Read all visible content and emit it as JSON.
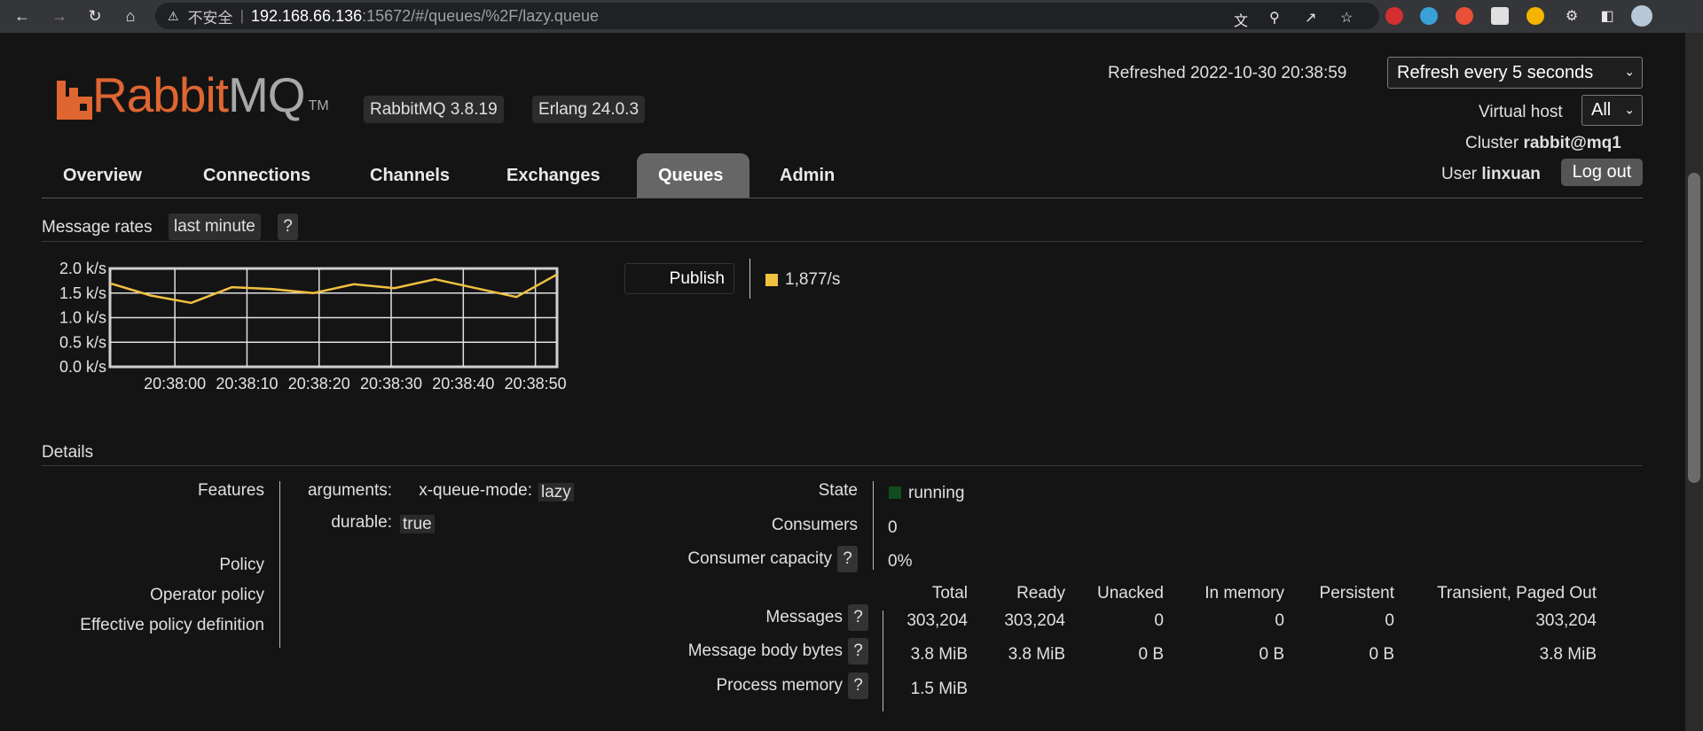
{
  "browser": {
    "security_label": "不安全",
    "url_host": "192.168.66.136",
    "url_path": ":15672/#/queues/%2F/lazy.queue"
  },
  "header": {
    "logo_rabbit": "Rabbit",
    "logo_mq": "MQ",
    "logo_tm": "TM",
    "version": "RabbitMQ 3.8.19",
    "erlang": "Erlang 24.0.3",
    "refreshed": "Refreshed 2022-10-30 20:38:59",
    "refresh_select": "Refresh every 5 seconds",
    "vhost_label": "Virtual host",
    "vhost_value": "All",
    "cluster_label": "Cluster",
    "cluster_value": "rabbit@mq1",
    "user_label": "User",
    "user_value": "linxuan",
    "logout_label": "Log out"
  },
  "tabs": [
    {
      "label": "Overview",
      "active": false
    },
    {
      "label": "Connections",
      "active": false
    },
    {
      "label": "Channels",
      "active": false
    },
    {
      "label": "Exchanges",
      "active": false
    },
    {
      "label": "Queues",
      "active": true
    },
    {
      "label": "Admin",
      "active": false
    }
  ],
  "message_rates": {
    "title": "Message rates",
    "range": "last minute",
    "help": "?",
    "legend_label": "Publish",
    "legend_value": "1,877/s",
    "legend_color": "#f0c040"
  },
  "chart_data": {
    "type": "line",
    "x": [
      "20:37:58",
      "20:38:03",
      "20:38:08",
      "20:38:13",
      "20:38:18",
      "20:38:23",
      "20:38:28",
      "20:38:33",
      "20:38:38",
      "20:38:43",
      "20:38:48",
      "20:38:53"
    ],
    "series": [
      {
        "name": "Publish",
        "color": "#f0c040",
        "values": [
          1700,
          1450,
          1300,
          1620,
          1580,
          1500,
          1680,
          1600,
          1780,
          1600,
          1420,
          1880
        ]
      }
    ],
    "x_ticks": [
      "20:38:00",
      "20:38:10",
      "20:38:20",
      "20:38:30",
      "20:38:40",
      "20:38:50"
    ],
    "y_ticks": [
      "0.0 k/s",
      "0.5 k/s",
      "1.0 k/s",
      "1.5 k/s",
      "2.0 k/s"
    ],
    "ylim": [
      0,
      2000
    ],
    "grid": true
  },
  "details": {
    "title": "Details",
    "features_label": "Features",
    "arguments_label": "arguments:",
    "arg_key": "x-queue-mode:",
    "arg_value": "lazy",
    "durable_label": "durable:",
    "durable_value": "true",
    "policy_label": "Policy",
    "operator_policy_label": "Operator policy",
    "effective_policy_label": "Effective policy definition",
    "state_label": "State",
    "state_value": "running",
    "state_color": "#0f4d1e",
    "consumers_label": "Consumers",
    "consumers_value": "0",
    "capacity_label": "Consumer capacity",
    "capacity_value": "0%",
    "help": "?"
  },
  "messages_table": {
    "columns": [
      "Total",
      "Ready",
      "Unacked",
      "In memory",
      "Persistent",
      "Transient, Paged Out"
    ],
    "rows": [
      {
        "label": "Messages",
        "cells": [
          "303,204",
          "303,204",
          "0",
          "0",
          "0",
          "303,204"
        ]
      },
      {
        "label": "Message body bytes",
        "cells": [
          "3.8 MiB",
          "3.8 MiB",
          "0 B",
          "0 B",
          "0 B",
          "3.8 MiB"
        ]
      },
      {
        "label": "Process memory",
        "cells": [
          "1.5 MiB"
        ]
      }
    ]
  }
}
